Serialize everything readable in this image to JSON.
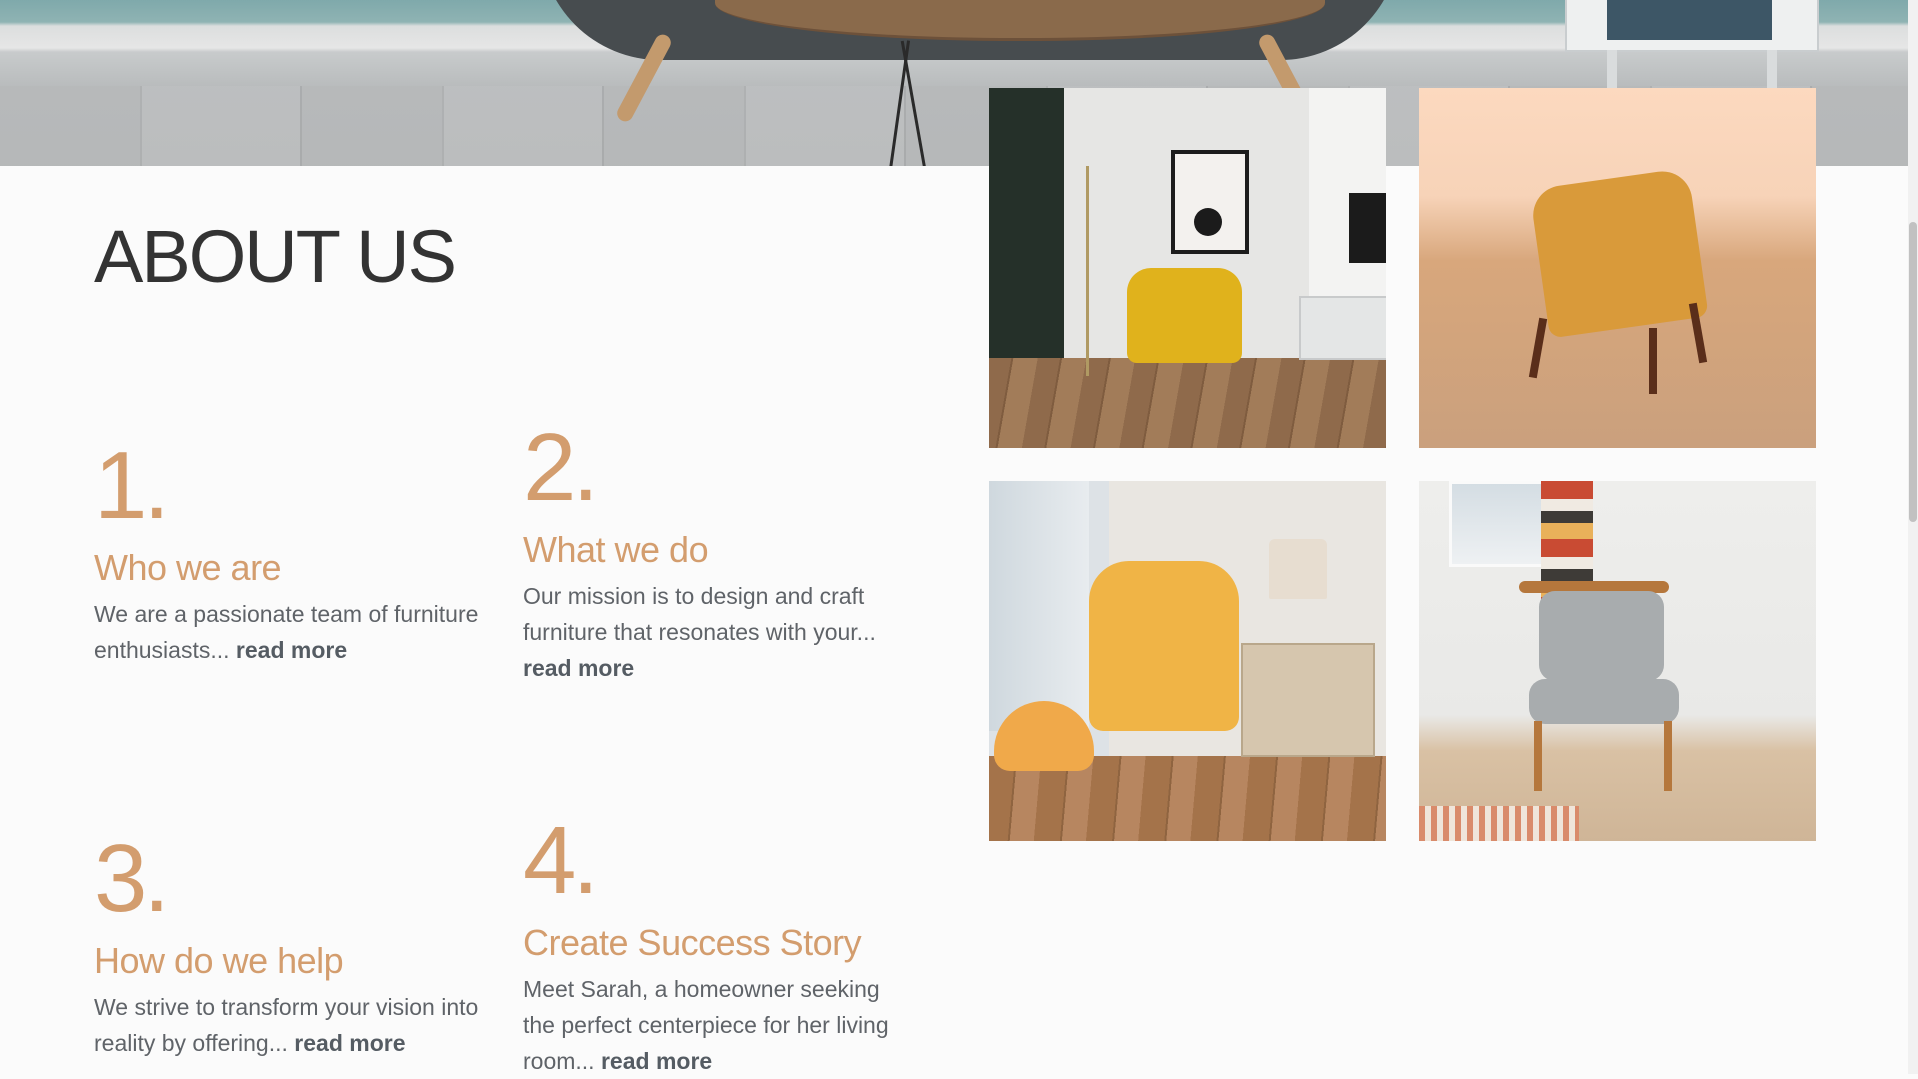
{
  "hero": {
    "image": "living-room-banner-photo"
  },
  "about": {
    "title": "ABOUT US",
    "items": [
      {
        "number": "1.",
        "heading": "Who we are",
        "description": "We are a passionate team of furniture enthusiasts...",
        "link": "read more"
      },
      {
        "number": "2.",
        "heading": "What we do",
        "description": "Our mission is to design and craft furniture that resonates with your...",
        "link": "read more"
      },
      {
        "number": "3.",
        "heading": "How do we help",
        "description": "We strive to transform your vision into reality by offering...",
        "link": "read more"
      },
      {
        "number": "4.",
        "heading": "Create Success Story",
        "description": "Meet Sarah, a homeowner seeking the perfect centerpiece for her living room...",
        "link": "read more"
      }
    ]
  },
  "gallery": {
    "photos": [
      "yellow-armchair-living-room-photo",
      "orange-armchair-corner-photo",
      "mustard-armchair-with-ottoman-photo",
      "wooden-chair-grey-cushion-photo"
    ]
  },
  "colors": {
    "accent": "#d39d6e",
    "title": "#333333",
    "text": "#5f6368",
    "background": "#fbfbfb"
  }
}
